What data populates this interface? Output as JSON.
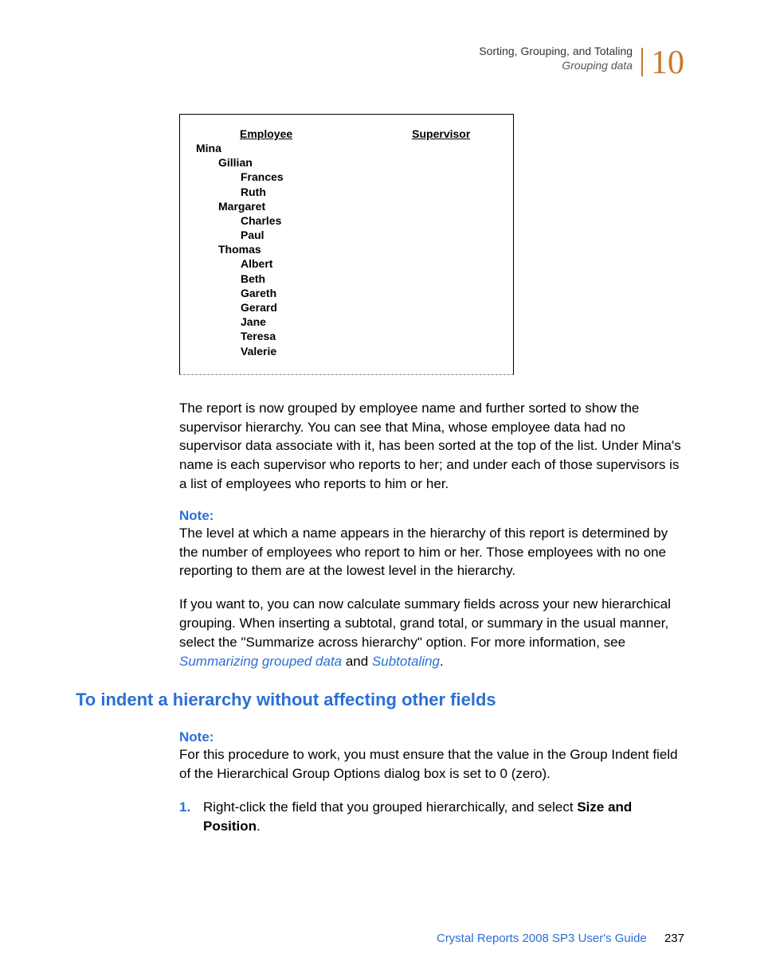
{
  "header": {
    "breadcrumb1": "Sorting, Grouping, and Totaling",
    "breadcrumb2": "Grouping data",
    "chapter": "10"
  },
  "report": {
    "col_employee": "Employee",
    "col_supervisor": "Supervisor",
    "rows": {
      "r0": "Mina",
      "r1": "Gillian",
      "r2": "Frances",
      "r3": "Ruth",
      "r4": "Margaret",
      "r5": "Charles",
      "r6": "Paul",
      "r7": "Thomas",
      "r8": "Albert",
      "r9": "Beth",
      "r10": "Gareth",
      "r11": "Gerard",
      "r12": "Jane",
      "r13": "Teresa",
      "r14": "Valerie"
    }
  },
  "paragraphs": {
    "p1": "The report is now grouped by employee name and further sorted to show the supervisor hierarchy. You can see that Mina, whose employee data had no supervisor data associate with it, has been sorted at the top of the list. Under Mina's name is each supervisor who reports to her; and under each of those supervisors is a list of employees who reports to him or her.",
    "note_label": "Note:",
    "p2": "The level at which a name appears in the hierarchy of this report is determined by the number of employees who report to him or her. Those employees with no one reporting to them are at the lowest level in the hierarchy.",
    "p3a": "If you want to, you can now calculate summary fields across your new hierarchical grouping. When inserting a subtotal, grand total, or summary in the usual manner, select the \"Summarize across hierarchy\" option. For more information, see ",
    "link1": "Summarizing grouped data",
    "p3b": " and ",
    "link2": "Subtotaling",
    "p3c": "."
  },
  "h2": "To indent a hierarchy without affecting other fields",
  "section2": {
    "note_label": "Note:",
    "p1": "For this procedure to work, you must ensure that the value in the Group Indent field of the Hierarchical Group Options dialog box is set to 0 (zero).",
    "step1_num": "1.",
    "step1a": "Right-click the field that you grouped hierarchically, and select ",
    "step1b": "Size and Position",
    "step1c": "."
  },
  "footer": {
    "text": "Crystal Reports 2008 SP3 User's Guide",
    "page": "237"
  }
}
